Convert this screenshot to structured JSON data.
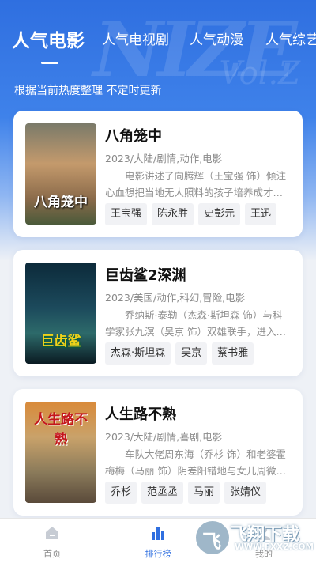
{
  "tabs": [
    {
      "label": "人气电影",
      "active": true
    },
    {
      "label": "人气电视剧",
      "active": false
    },
    {
      "label": "人气动漫",
      "active": false
    },
    {
      "label": "人气综艺",
      "active": false
    }
  ],
  "subtitle": "根据当前热度整理 不定时更新",
  "movies": [
    {
      "title": "八角笼中",
      "meta": "2023/大陆/剧情,动作,电影",
      "desc": "电影讲述了向腾辉（王宝强 饰）倾注心血想把当地无人照料的孩子培养成才…",
      "poster_text": "八角笼中",
      "cast": [
        "王宝强",
        "陈永胜",
        "史彭元",
        "王迅"
      ]
    },
    {
      "title": "巨齿鲨2深渊",
      "meta": "2023/美国/动作,科幻,冒险,电影",
      "desc": "乔纳斯·泰勒（杰森·斯坦森 饰）与科学家张九溟（吴京 饰）双雄联手，进入…",
      "poster_text": "巨齿鲨",
      "cast": [
        "杰森·斯坦森",
        "吴京",
        "蔡书雅"
      ]
    },
    {
      "title": "人生路不熟",
      "meta": "2023/大陆/剧情,喜剧,电影",
      "desc": "车队大佬周东海（乔杉 饰）和老婆霍梅梅（马丽 饰）阴差阳错地与女儿周微…",
      "poster_text": "人生路不熟",
      "cast": [
        "乔杉",
        "范丞丞",
        "马丽",
        "张婧仪"
      ]
    }
  ],
  "nav": [
    {
      "label": "首页",
      "icon": "home-icon",
      "active": false
    },
    {
      "label": "排行榜",
      "icon": "ranking-icon",
      "active": true
    },
    {
      "label": "我的",
      "icon": "profile-icon",
      "active": false
    }
  ],
  "watermark": {
    "text": "飞翔下载",
    "url": "WWW.FXXZ.COM"
  },
  "colors": {
    "accent": "#2f6fe0",
    "chip_bg": "#f1f2f5"
  }
}
